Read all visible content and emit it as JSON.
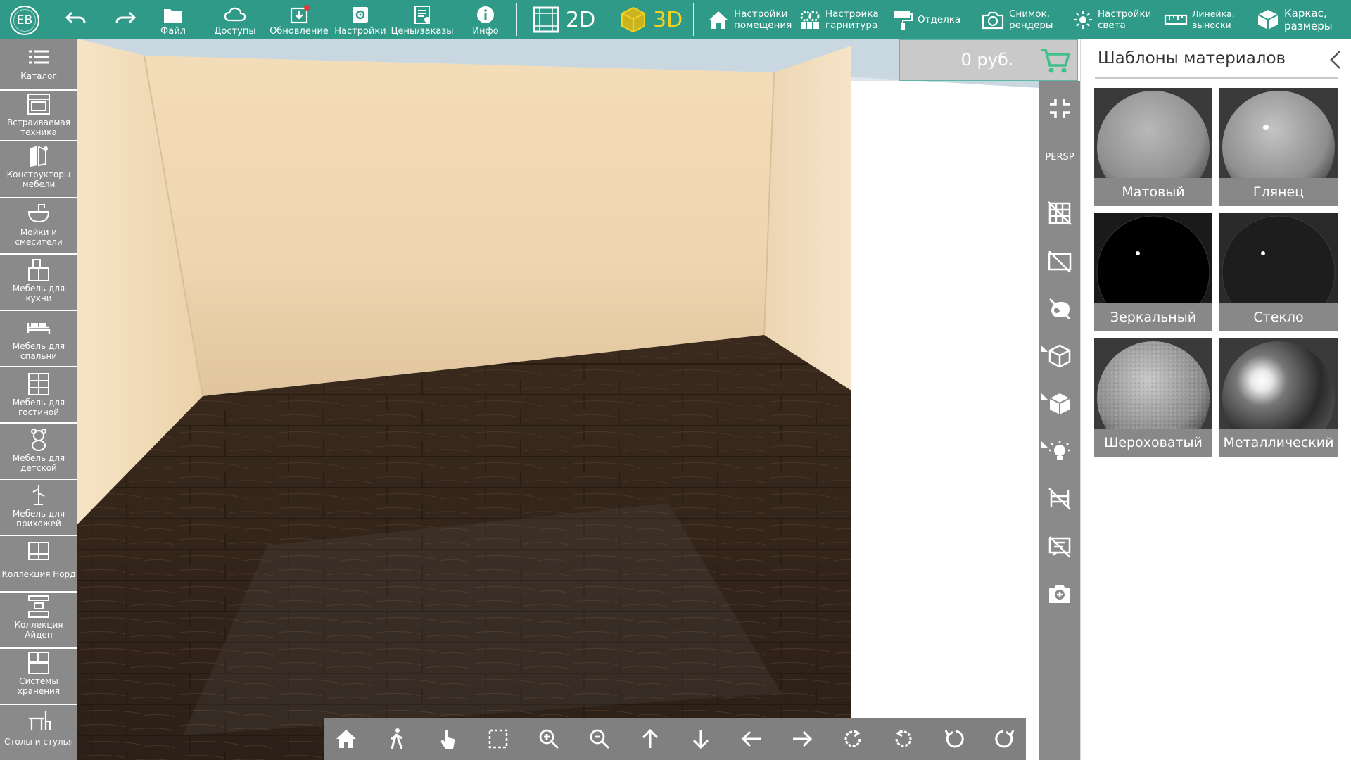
{
  "topbar": {
    "avatar_initials": "EB",
    "file_label": "Файл",
    "access_label": "Доступы",
    "update_label": "Обновление",
    "settings_label": "Настройки",
    "prices_label": "Цены/заказы",
    "info_label": "Инфо",
    "mode_2d": "2D",
    "mode_3d": "3D",
    "room_settings_l1": "Настройки",
    "room_settings_l2": "помещения",
    "headset_settings_l1": "Настройка",
    "headset_settings_l2": "гарнитура",
    "finish_label": "Отделка",
    "snapshot_l1": "Снимок,",
    "snapshot_l2": "рендеры",
    "light_l1": "Настройки",
    "light_l2": "света",
    "ruler_l1": "Линейка,",
    "ruler_l2": "выноски",
    "frame_l1": "Каркас,",
    "frame_l2": "размеры",
    "accent_color": "#2e9a87",
    "mode_3d_color": "#f5d21f"
  },
  "sidebar": {
    "items": [
      {
        "label": "Каталог",
        "icon": "list-icon"
      },
      {
        "label": "Встраиваемая техника",
        "icon": "oven-icon"
      },
      {
        "label": "Конструкторы мебели",
        "icon": "furniture-constructor-icon"
      },
      {
        "label": "Мойки и смесители",
        "icon": "sink-icon"
      },
      {
        "label": "Мебель для кухни",
        "icon": "kitchen-icon"
      },
      {
        "label": "Мебель для спальни",
        "icon": "bed-icon"
      },
      {
        "label": "Мебель для гостиной",
        "icon": "shelf-icon"
      },
      {
        "label": "Мебель для детской",
        "icon": "teddy-bear-icon"
      },
      {
        "label": "Мебель для прихожей",
        "icon": "hanger-icon"
      },
      {
        "label": "Коллекция Норд",
        "icon": "cabinet-icon"
      },
      {
        "label": "Коллекция Айден",
        "icon": "network-icon"
      },
      {
        "label": "Системы хранения",
        "icon": "storage-icon"
      },
      {
        "label": "Столы и стулья",
        "icon": "table-chair-icon"
      }
    ]
  },
  "price": {
    "value": "0 руб."
  },
  "toolcol": {
    "persp_label": "PERSP"
  },
  "panel": {
    "title": "Шаблоны материалов",
    "materials": [
      {
        "label": "Матовый"
      },
      {
        "label": "Глянец"
      },
      {
        "label": "Зеркальный"
      },
      {
        "label": "Стекло"
      },
      {
        "label": "Шероховатый"
      },
      {
        "label": "Металлический"
      }
    ]
  }
}
